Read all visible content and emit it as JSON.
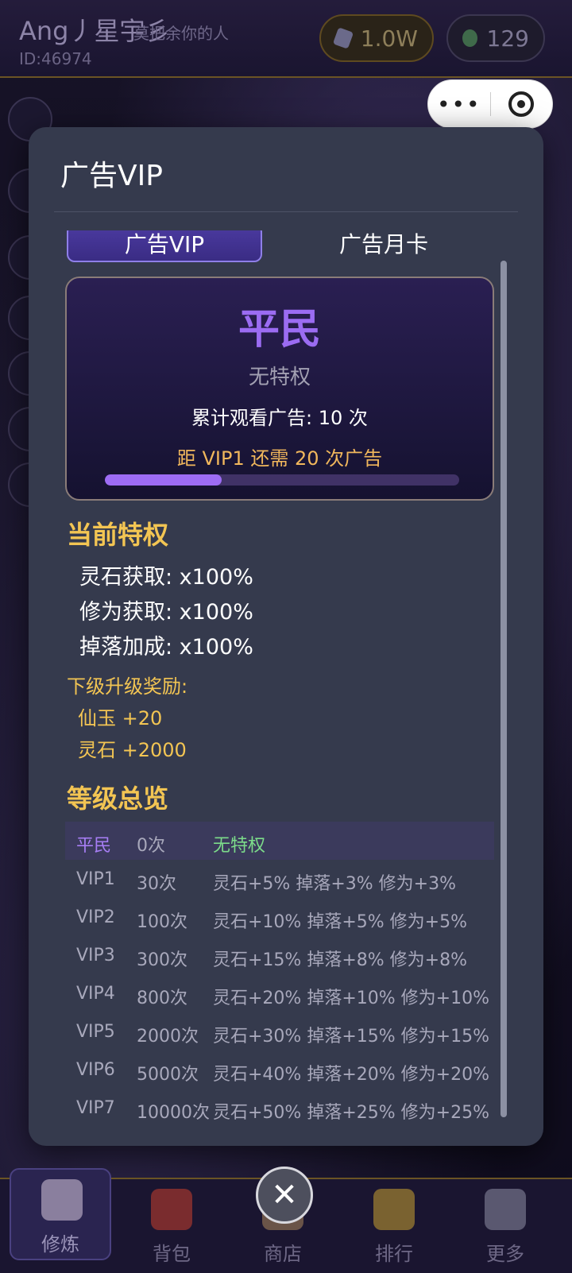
{
  "header": {
    "player_name": "Ang丿星宇彡",
    "player_sign": "莫把余你的人",
    "player_id": "ID:46974",
    "currency_stones": "1.0W",
    "currency_jade": "129",
    "capsule_more": "•••"
  },
  "modal": {
    "title": "广告VIP",
    "tabs": [
      {
        "label": "广告VIP",
        "active": true
      },
      {
        "label": "广告月卡",
        "active": false
      }
    ],
    "vip_card": {
      "level_name": "平民",
      "perk_text": "无特权",
      "watched_text": "累计观看广告: 10 次",
      "next_text": "距 VIP1 还需 20 次广告",
      "progress": 0.33
    },
    "current_privileges_title": "当前特权",
    "current_privileges": [
      "灵石获取: x100%",
      "修为获取: x100%",
      "掉落加成: x100%"
    ],
    "next_reward_title": "下级升级奖励:",
    "next_rewards": [
      "仙玉 +20",
      "灵石 +2000"
    ],
    "levels_title": "等级总览",
    "levels": [
      {
        "name": "平民",
        "count": "0次",
        "perks": "无特权",
        "current": true
      },
      {
        "name": "VIP1",
        "count": "30次",
        "perks": "灵石+5% 掉落+3% 修为+3%"
      },
      {
        "name": "VIP2",
        "count": "100次",
        "perks": "灵石+10% 掉落+5% 修为+5%"
      },
      {
        "name": "VIP3",
        "count": "300次",
        "perks": "灵石+15% 掉落+8% 修为+8%"
      },
      {
        "name": "VIP4",
        "count": "800次",
        "perks": "灵石+20% 掉落+10% 修为+10%"
      },
      {
        "name": "VIP5",
        "count": "2000次",
        "perks": "灵石+30% 掉落+15% 修为+15%"
      },
      {
        "name": "VIP6",
        "count": "5000次",
        "perks": "灵石+40% 掉落+20% 修为+20%"
      },
      {
        "name": "VIP7",
        "count": "10000次",
        "perks": "灵石+50% 掉落+25% 修为+25%"
      }
    ]
  },
  "bottom_nav": [
    {
      "label": "修炼",
      "active": true,
      "icon": "swords-icon",
      "color": "#8a7f9e"
    },
    {
      "label": "背包",
      "active": false,
      "icon": "backpack-icon",
      "color": "#7a2c2e"
    },
    {
      "label": "商店",
      "active": false,
      "icon": "shop-icon",
      "color": "#6a5448"
    },
    {
      "label": "排行",
      "active": false,
      "icon": "trophy-icon",
      "color": "#7a6230"
    },
    {
      "label": "更多",
      "active": false,
      "icon": "clipboard-icon",
      "color": "#5a5870"
    }
  ],
  "close_label": "✕"
}
